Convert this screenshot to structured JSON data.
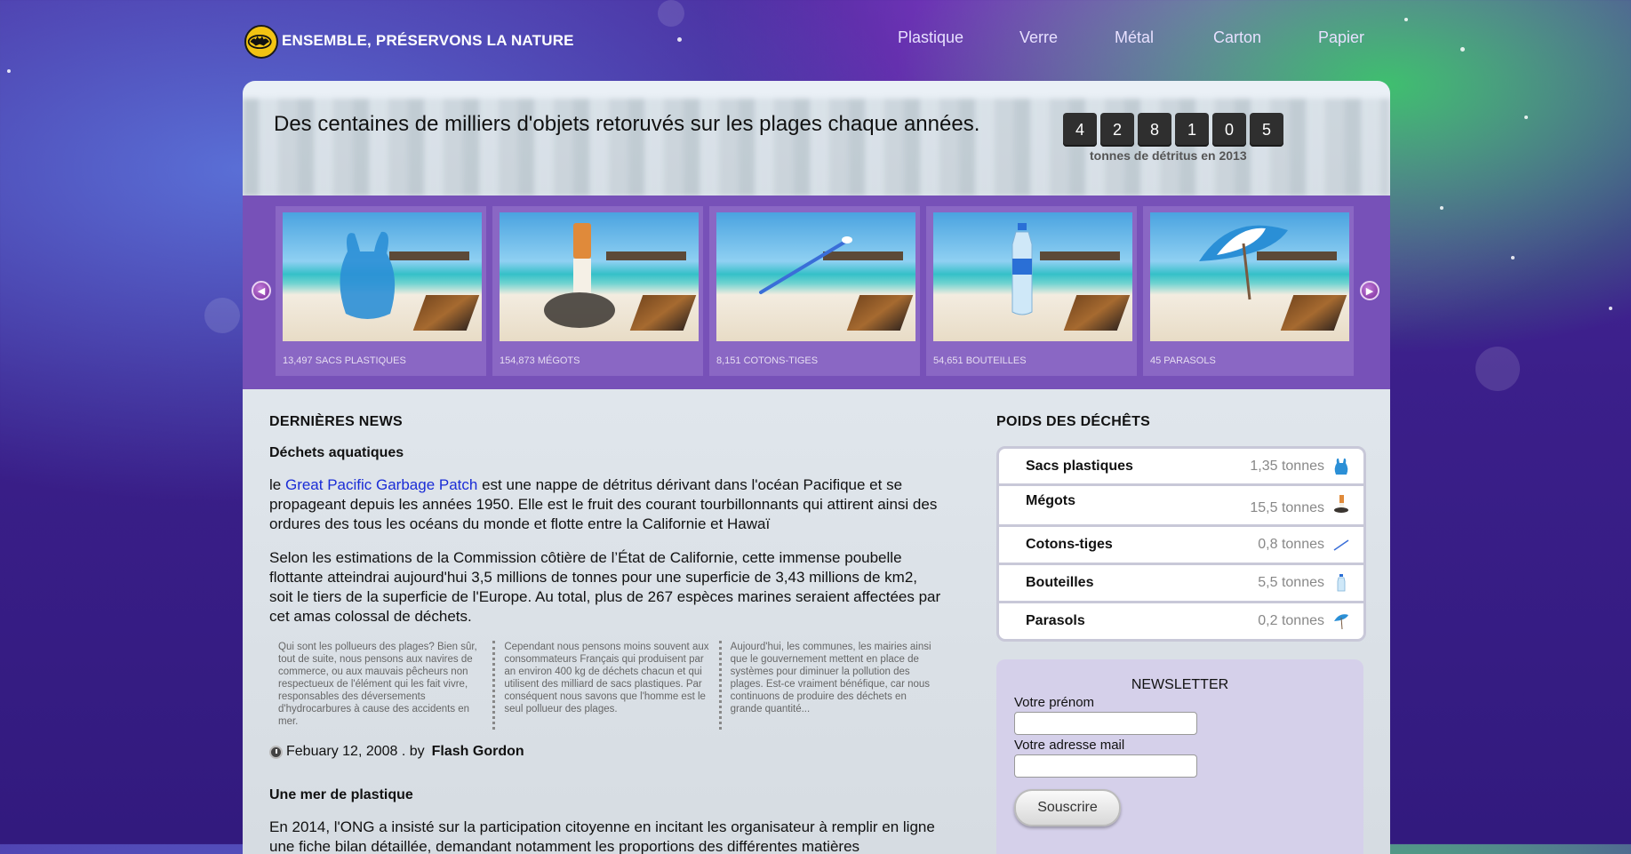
{
  "header": {
    "title": "ENSEMBLE, PRÉSERVONS LA NATURE",
    "nav": [
      "Plastique",
      "Verre",
      "Métal",
      "Carton",
      "Papier"
    ]
  },
  "hero": {
    "tagline": "Des centaines de milliers d'objets retoruvés sur les plages chaque années.",
    "counter_digits": [
      "4",
      "2",
      "8",
      "1",
      "0",
      "5"
    ],
    "counter_caption": "tonnes de détritus en 2013"
  },
  "carousel": {
    "slides": [
      {
        "caption": "13,497 SACS PLASTIQUES",
        "icon": "plastic-bag-icon"
      },
      {
        "caption": "154,873 MÉGOTS",
        "icon": "cigarette-butt-icon"
      },
      {
        "caption": "8,151 COTONS-TIGES",
        "icon": "cotton-swab-icon"
      },
      {
        "caption": "54,651 BOUTEILLES",
        "icon": "bottle-icon"
      },
      {
        "caption": "45 PARASOLS",
        "icon": "parasol-icon"
      }
    ]
  },
  "news": {
    "section_title": "DERNIÈRES NEWS",
    "article1": {
      "title": "Déchets aquatiques",
      "p1_prefix": "le ",
      "p1_link": "Great Pacific Garbage Patch",
      "p1_rest": " est une nappe de détritus dérivant dans l'océan Pacifique et se propageant depuis les années 1950. Elle est le fruit des courant tourbillonnants qui attirent ainsi des ordures des tous les océans du monde et flotte entre la Californie et Hawaï",
      "p2": "Selon les estimations de la Commission côtière de l’État de Californie, cette immense poubelle flottante atteindrai aujourd'hui 3,5 millions de tonnes pour une superficie de 3,43 millions de km2, soit le tiers de la superficie de l'Europe. Au total, plus de 267 espèces marines seraient affectées par cet amas colossal de déchets.",
      "cols": [
        "Qui sont les pollueurs des plages? Bien sûr, tout de suite, nous pensons aux navires de commerce, ou aux mauvais pêcheurs non respectueux de l'élément qui les fait vivre, responsables des déversements d'hydrocarbures à cause des accidents en mer.",
        "Cependant nous pensons moins souvent aux consommateurs Français qui produisent par an environ 400 kg de déchets chacun et qui utilisent des milliard de sacs plastiques. Par conséquent nous savons que l'homme est le seul pollueur des plages.",
        "Aujourd'hui, les communes, les mairies ainsi que le gouvernement mettent en place de systèmes pour diminuer la pollution des plages. Est-ce vraiment bénéfique, car nous continuons de produire des déchets en grande quantité..."
      ],
      "date": "Febuary 12, 2008 . by",
      "author": "Flash Gordon"
    },
    "article2": {
      "title": "Une mer de plastique",
      "p1": "En 2014, l'ONG a insisté sur la participation citoyenne en incitant les organisateur à remplir en ligne une fiche bilan détaillée, demandant notamment les proportions des différentes matières"
    }
  },
  "weights": {
    "section_title": "POIDS DES DÉCHÊTS",
    "rows": [
      {
        "name": "Sacs plastiques",
        "value": "1,35 tonnes",
        "icon": "plastic-bag-icon"
      },
      {
        "name": "Mégots",
        "value": "15,5 tonnes",
        "icon": "cigarette-butt-icon"
      },
      {
        "name": "Cotons-tiges",
        "value": "0,8 tonnes",
        "icon": "cotton-swab-icon"
      },
      {
        "name": "Bouteilles",
        "value": "5,5 tonnes",
        "icon": "bottle-icon"
      },
      {
        "name": "Parasols",
        "value": "0,2 tonnes",
        "icon": "parasol-icon"
      }
    ]
  },
  "newsletter": {
    "title": "NEWSLETTER",
    "firstname_label": "Votre prénom",
    "email_label": "Votre adresse mail",
    "button_label": "Souscrire"
  }
}
